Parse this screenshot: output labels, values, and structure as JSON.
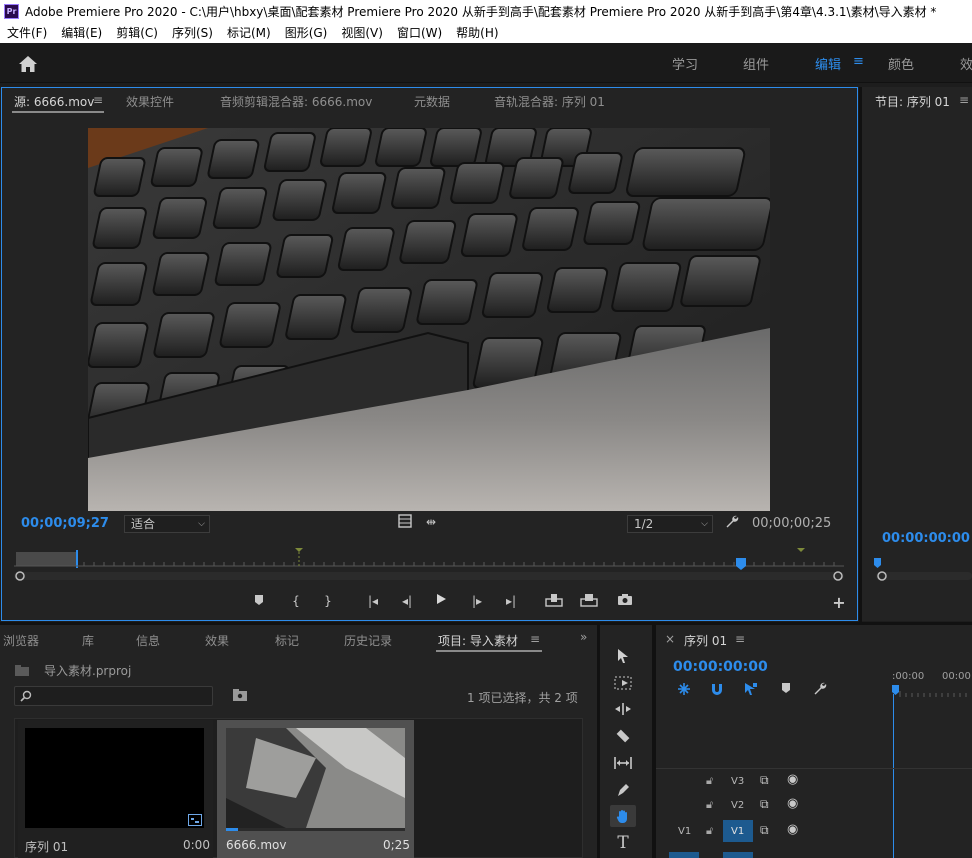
{
  "window": {
    "app_icon": "Pr",
    "title": "Adobe Premiere Pro 2020 - C:\\用户\\hbxy\\桌面\\配套素材 Premiere Pro 2020 从新手到高手\\配套素材 Premiere Pro 2020 从新手到高手\\第4章\\4.3.1\\素材\\导入素材 *"
  },
  "menu": [
    "文件(F)",
    "编辑(E)",
    "剪辑(C)",
    "序列(S)",
    "标记(M)",
    "图形(G)",
    "视图(V)",
    "窗口(W)",
    "帮助(H)"
  ],
  "workspaces": [
    {
      "label": "学习",
      "active": false
    },
    {
      "label": "组件",
      "active": false
    },
    {
      "label": "编辑",
      "active": true
    },
    {
      "label": "颜色",
      "active": false
    },
    {
      "label": "效",
      "active": false
    }
  ],
  "source_panel": {
    "tabs": [
      "源: 6666.mov",
      "效果控件",
      "音频剪辑混合器: 6666.mov",
      "元数据",
      "音轨混合器: 序列 01"
    ],
    "timecode_current": "00;00;09;27",
    "fit_label": "适合",
    "resolution": "1/2",
    "timecode_duration": "00;00;00;25"
  },
  "program_panel": {
    "tab": "节目: 序列 01",
    "timecode": "00:00:00:00"
  },
  "project_panel": {
    "tabs": [
      "浏览器",
      "库",
      "信息",
      "效果",
      "标记",
      "历史记录",
      "项目: 导入素材"
    ],
    "active_tab": "项目: 导入素材",
    "file_name": "导入素材.prproj",
    "search_placeholder": "",
    "selection_status": "1 项已选择，共 2 项",
    "items": [
      {
        "name": "序列 01",
        "duration": "0:00"
      },
      {
        "name": "6666.mov",
        "duration": "0;25"
      }
    ]
  },
  "timeline_panel": {
    "tab": "序列 01",
    "timecode": "00:00:00:00",
    "ruler_label": ":00:00",
    "ruler_label_2": "00:00",
    "tracks": [
      {
        "source": "",
        "name": "V3"
      },
      {
        "source": "",
        "name": "V2"
      },
      {
        "source": "V1",
        "name": "V1"
      }
    ]
  },
  "colors": {
    "accent": "#2d8ceb",
    "panel_bg": "#232323",
    "marker_green": "#7d8a3a"
  },
  "icons": {
    "home": "home-icon",
    "wrench": "wrench-icon",
    "camera": "camera-icon",
    "add": "plus-icon"
  }
}
